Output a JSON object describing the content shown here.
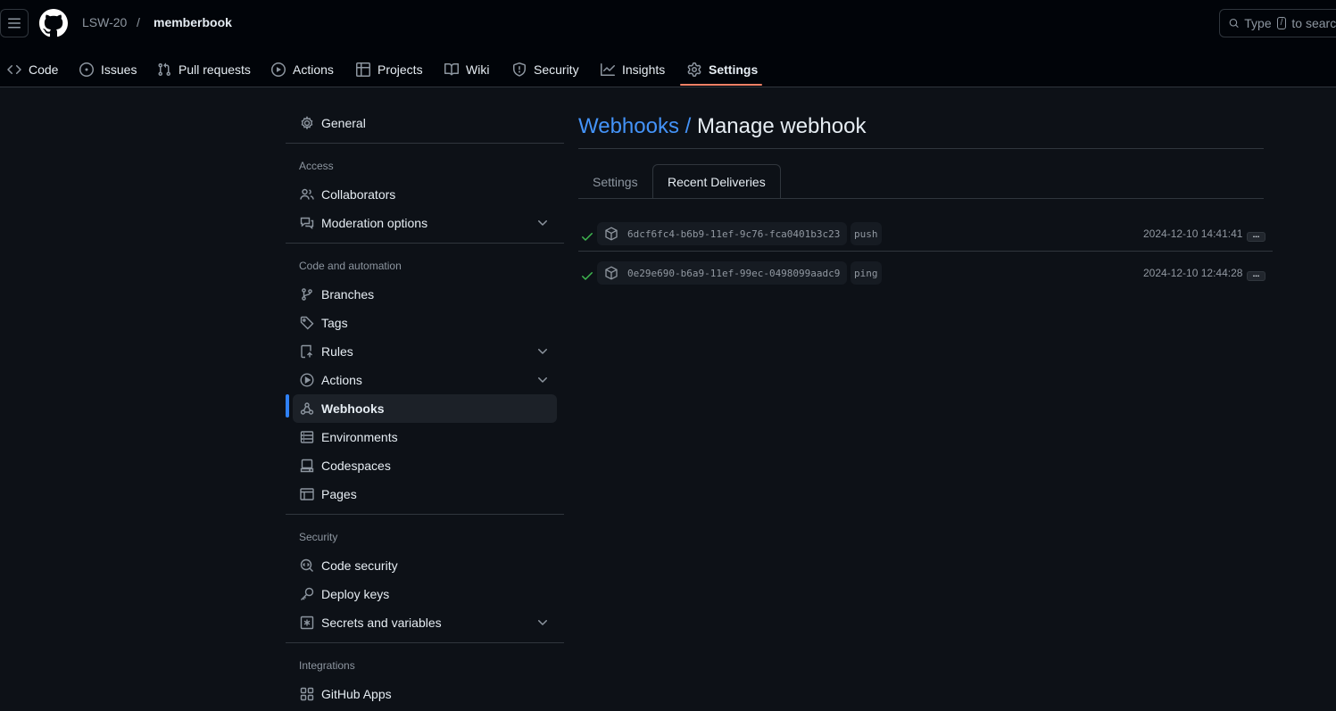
{
  "header": {
    "owner": "LSW-20",
    "separator": "/",
    "repo": "memberbook",
    "search_text": "Type",
    "search_kbd": "/",
    "search_suffix": "to search"
  },
  "nav": {
    "tabs": [
      {
        "label": "Code",
        "icon": "code-icon"
      },
      {
        "label": "Issues",
        "icon": "issue-icon"
      },
      {
        "label": "Pull requests",
        "icon": "pull-request-icon"
      },
      {
        "label": "Actions",
        "icon": "play-icon"
      },
      {
        "label": "Projects",
        "icon": "table-icon"
      },
      {
        "label": "Wiki",
        "icon": "book-icon"
      },
      {
        "label": "Security",
        "icon": "shield-icon"
      },
      {
        "label": "Insights",
        "icon": "graph-icon"
      },
      {
        "label": "Settings",
        "icon": "gear-icon",
        "active": true
      }
    ]
  },
  "sidebar": {
    "general": "General",
    "sections": {
      "access": "Access",
      "code_automation": "Code and automation",
      "security": "Security",
      "integrations": "Integrations"
    },
    "items": {
      "collaborators": "Collaborators",
      "moderation": "Moderation options",
      "branches": "Branches",
      "tags": "Tags",
      "rules": "Rules",
      "actions": "Actions",
      "webhooks": "Webhooks",
      "environments": "Environments",
      "codespaces": "Codespaces",
      "pages": "Pages",
      "code_security": "Code security",
      "deploy_keys": "Deploy keys",
      "secrets": "Secrets and variables",
      "github_apps": "GitHub Apps"
    },
    "active_item": "Webhooks"
  },
  "main": {
    "title_link": "Webhooks /",
    "title": "Manage webhook",
    "tabs": [
      "Settings",
      "Recent Deliveries"
    ],
    "active_tab": "Recent Deliveries",
    "deliveries": [
      {
        "guid": "6dcf6fc4-b6b9-11ef-9c76-fca0401b3c23",
        "event": "push",
        "time": "2024-12-10 14:41:41",
        "status": "success",
        "more": "..."
      },
      {
        "guid": "0e29e690-b6a9-11ef-99ec-0498099aadc9",
        "event": "ping",
        "time": "2024-12-10 12:44:28",
        "status": "success",
        "more": "..."
      }
    ]
  },
  "colors": {
    "background": "#0d1117",
    "header": "#010409",
    "link": "#4493f8",
    "active_underline": "#f78166",
    "success": "#3fb950",
    "active_bar": "#2f81f7"
  }
}
